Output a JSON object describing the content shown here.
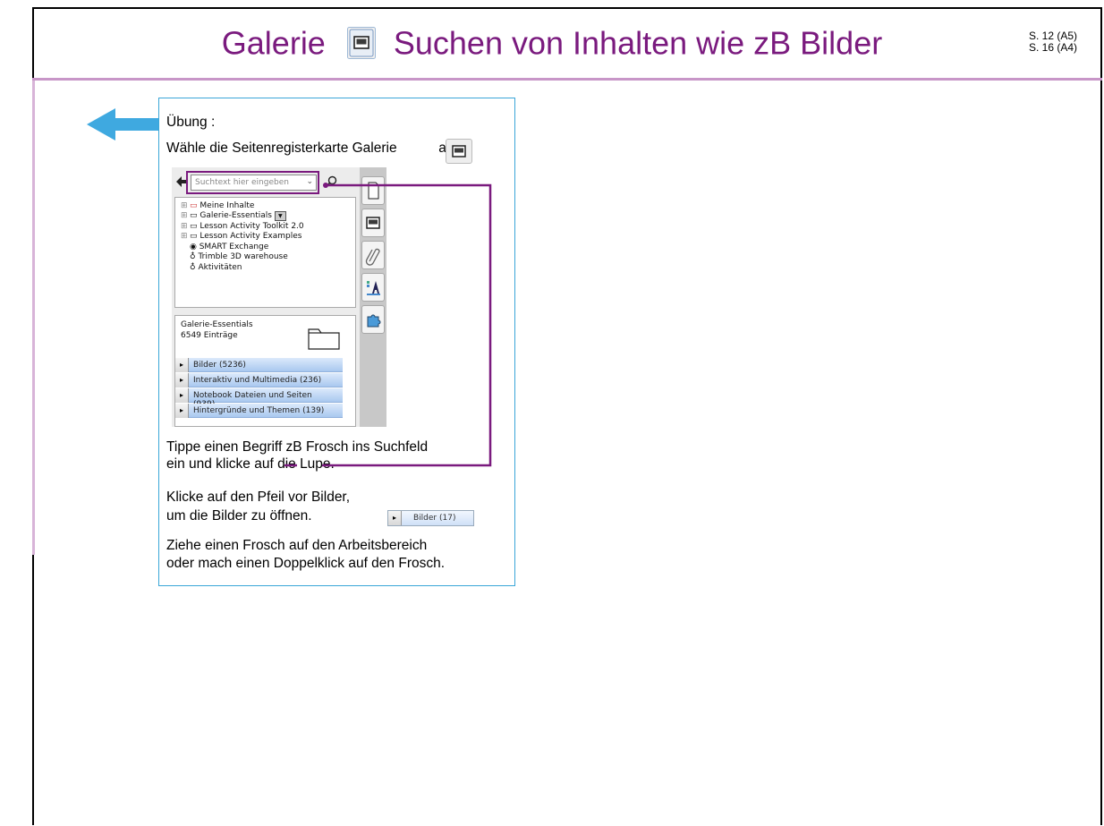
{
  "header": {
    "title_part1": "Galerie",
    "title_part2": "Suchen von Inhalten wie zB Bilder",
    "page_ref_a5": "S. 12 (A5)",
    "page_ref_a4": "S. 16 (A4)",
    "gallery_icon": "gallery-tab-icon"
  },
  "exercise": {
    "heading": "Übung :",
    "step1_prefix": "Wähle die Seitenregisterkarte Galerie",
    "step1_suffix": "aus.",
    "step2_line1": "Tippe einen Begriff zB Frosch ins Suchfeld",
    "step2_line2": "ein und klicke auf die Lupe.",
    "step3_line1": "Klicke auf den Pfeil vor Bilder,",
    "step3_line2": "um die Bilder zu öffnen.",
    "step3_button": "Bilder (17)",
    "step4_line1": "Ziehe einen Frosch auf den Arbeitsbereich",
    "step4_line2": "oder mach einen Doppelklick auf den Frosch."
  },
  "gallery_panel": {
    "search_placeholder": "Suchtext hier eingeben",
    "tree": [
      "Meine Inhalte",
      "Galerie-Essentials",
      "Lesson Activity Toolkit 2.0",
      "Lesson Activity Examples",
      "SMART Exchange",
      "Trimble 3D warehouse",
      "Aktivitäten"
    ],
    "selected_name": "Galerie-Essentials",
    "selected_count": "6549 Einträge",
    "categories": [
      "Bilder (5236)",
      "Interaktiv und Multimedia (236)",
      "Notebook Dateien und Seiten",
      "Hintergründe und Themen (139)"
    ],
    "category_overflow": "(939)"
  },
  "colors": {
    "title": "#7a1a7e",
    "accent_line": "#c896c8",
    "box_border": "#3aa6d8",
    "back_arrow": "#3fa9e0",
    "connector": "#7a1a7e"
  }
}
